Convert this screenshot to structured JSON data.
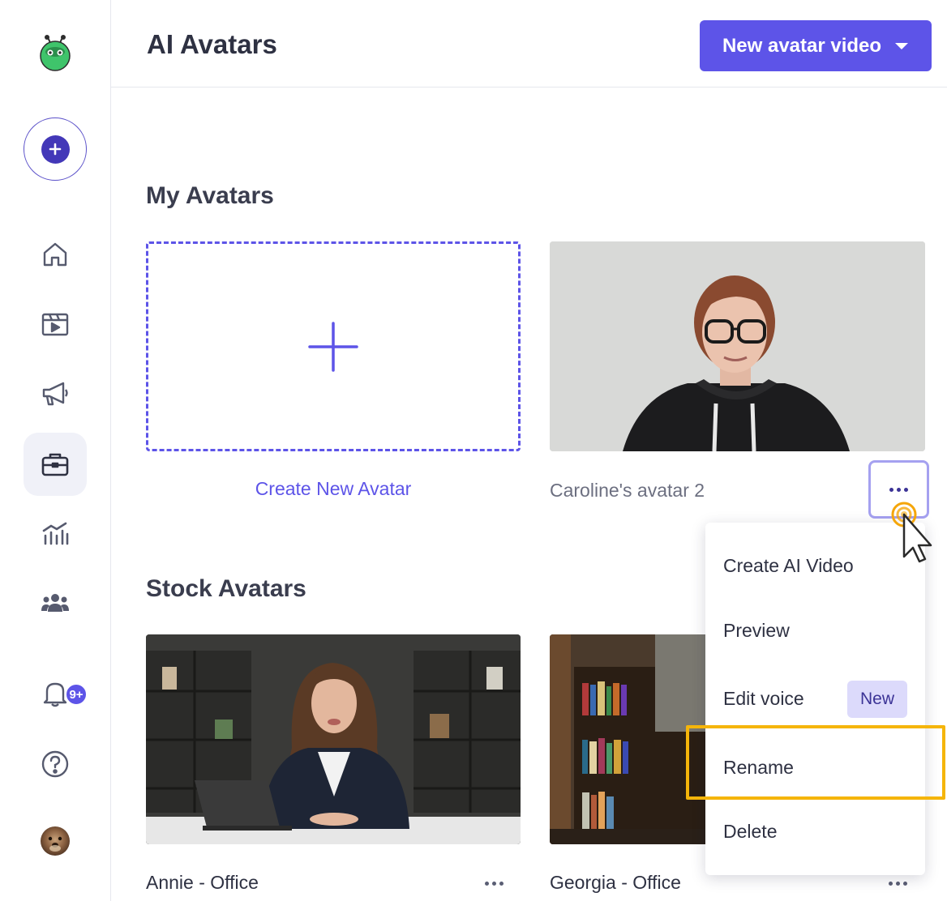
{
  "header": {
    "title": "AI Avatars",
    "new_video_label": "New avatar video"
  },
  "sidebar": {
    "notification_count": "9+"
  },
  "my_avatars": {
    "title": "My Avatars",
    "create_label": "Create New Avatar",
    "items": [
      {
        "name": "Caroline's avatar 2"
      }
    ]
  },
  "stock_avatars": {
    "title": "Stock Avatars",
    "items": [
      {
        "name": "Annie - Office"
      },
      {
        "name": "Georgia - Office"
      }
    ]
  },
  "menu": {
    "items": [
      {
        "label": "Create AI Video"
      },
      {
        "label": "Preview"
      },
      {
        "label": "Edit voice",
        "badge": "New"
      },
      {
        "label": "Rename"
      },
      {
        "label": "Delete"
      }
    ]
  },
  "colors": {
    "accent": "#5d54e8",
    "highlight": "#f5b50a"
  }
}
